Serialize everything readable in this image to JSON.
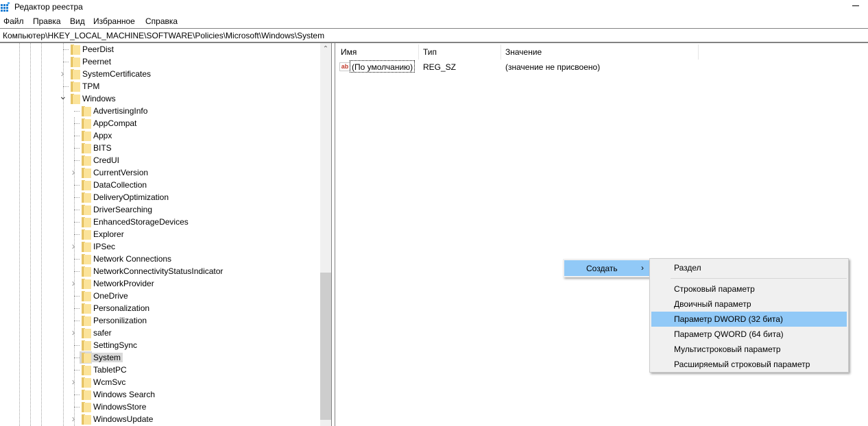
{
  "window": {
    "title": "Редактор реестра",
    "icon": "registry-editor-icon"
  },
  "menu": [
    "Файл",
    "Правка",
    "Вид",
    "Избранное",
    "Справка"
  ],
  "address": "Компьютер\\HKEY_LOCAL_MACHINE\\SOFTWARE\\Policies\\Microsoft\\Windows\\System",
  "tree": {
    "items": [
      {
        "label": "PeerDist",
        "level": 0,
        "expander": "none"
      },
      {
        "label": "Peernet",
        "level": 0,
        "expander": "none"
      },
      {
        "label": "SystemCertificates",
        "level": 0,
        "expander": "collapsed"
      },
      {
        "label": "TPM",
        "level": 0,
        "expander": "none"
      },
      {
        "label": "Windows",
        "level": 0,
        "expander": "expanded"
      },
      {
        "label": "AdvertisingInfo",
        "level": 1,
        "expander": "none"
      },
      {
        "label": "AppCompat",
        "level": 1,
        "expander": "none"
      },
      {
        "label": "Appx",
        "level": 1,
        "expander": "none"
      },
      {
        "label": "BITS",
        "level": 1,
        "expander": "none"
      },
      {
        "label": "CredUI",
        "level": 1,
        "expander": "none"
      },
      {
        "label": "CurrentVersion",
        "level": 1,
        "expander": "collapsed"
      },
      {
        "label": "DataCollection",
        "level": 1,
        "expander": "none"
      },
      {
        "label": "DeliveryOptimization",
        "level": 1,
        "expander": "none"
      },
      {
        "label": "DriverSearching",
        "level": 1,
        "expander": "none"
      },
      {
        "label": "EnhancedStorageDevices",
        "level": 1,
        "expander": "none"
      },
      {
        "label": "Explorer",
        "level": 1,
        "expander": "none"
      },
      {
        "label": "IPSec",
        "level": 1,
        "expander": "collapsed"
      },
      {
        "label": "Network Connections",
        "level": 1,
        "expander": "none"
      },
      {
        "label": "NetworkConnectivityStatusIndicator",
        "level": 1,
        "expander": "none"
      },
      {
        "label": "NetworkProvider",
        "level": 1,
        "expander": "collapsed"
      },
      {
        "label": "OneDrive",
        "level": 1,
        "expander": "none"
      },
      {
        "label": "Personalization",
        "level": 1,
        "expander": "none"
      },
      {
        "label": "Personilization",
        "level": 1,
        "expander": "none"
      },
      {
        "label": "safer",
        "level": 1,
        "expander": "collapsed"
      },
      {
        "label": "SettingSync",
        "level": 1,
        "expander": "none"
      },
      {
        "label": "System",
        "level": 1,
        "expander": "none",
        "selected": true
      },
      {
        "label": "TabletPC",
        "level": 1,
        "expander": "none"
      },
      {
        "label": "WcmSvc",
        "level": 1,
        "expander": "collapsed"
      },
      {
        "label": "Windows Search",
        "level": 1,
        "expander": "none"
      },
      {
        "label": "WindowsStore",
        "level": 1,
        "expander": "none"
      },
      {
        "label": "WindowsUpdate",
        "level": 1,
        "expander": "collapsed"
      }
    ]
  },
  "list": {
    "columns": [
      "Имя",
      "Тип",
      "Значение"
    ],
    "rows": [
      {
        "icon": "string-value-icon",
        "icon_text": "ab",
        "name": "(По умолчанию)",
        "type": "REG_SZ",
        "value": "(значение не присвоено)"
      }
    ]
  },
  "context_menu": {
    "item": "Создать",
    "arrow": "›",
    "submenu": [
      {
        "label": "Раздел"
      },
      {
        "separator": true
      },
      {
        "label": "Строковый параметр"
      },
      {
        "label": "Двоичный параметр"
      },
      {
        "label": "Параметр DWORD (32 бита)",
        "highlighted": true
      },
      {
        "label": "Параметр QWORD (64 бита)"
      },
      {
        "label": "Мультистроковый параметр"
      },
      {
        "label": "Расширяемый строковый параметр"
      }
    ]
  },
  "colors": {
    "highlight": "#91c9f7",
    "selection": "#d9d9d9",
    "folder": "#fbe39a"
  }
}
